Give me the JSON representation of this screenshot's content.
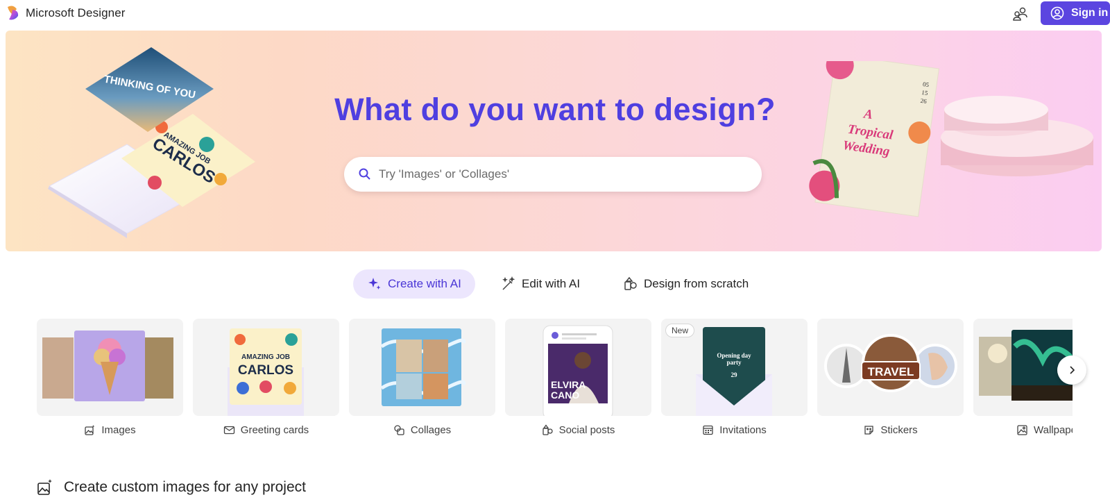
{
  "app": {
    "name": "Microsoft Designer"
  },
  "header": {
    "signin_label": "Sign in",
    "share_icon": "people-share-icon"
  },
  "hero": {
    "title": "What do you want to design?",
    "search_placeholder": "Try 'Images' or 'Collages'",
    "postcard_text": "THINKING OF YOU",
    "card_text": [
      "AMAZING JOB",
      "CARLOS"
    ],
    "invite_title": "A Tropical Wedding",
    "invite_date": [
      "05",
      "15",
      "26"
    ]
  },
  "tabs": [
    {
      "label": "Create with AI",
      "icon": "sparkle-icon",
      "active": true
    },
    {
      "label": "Edit with AI",
      "icon": "magic-wand-icon",
      "active": false
    },
    {
      "label": "Design from scratch",
      "icon": "shapes-icon",
      "active": false
    }
  ],
  "categories": [
    {
      "label": "Images",
      "icon": "image-sparkle-icon"
    },
    {
      "label": "Greeting cards",
      "icon": "mail-icon"
    },
    {
      "label": "Collages",
      "icon": "collage-icon"
    },
    {
      "label": "Social posts",
      "icon": "social-post-icon"
    },
    {
      "label": "Invitations",
      "icon": "calendar-icon",
      "badge": "New"
    },
    {
      "label": "Stickers",
      "icon": "sticker-icon"
    },
    {
      "label": "Wallpape",
      "icon": "wallpaper-icon"
    }
  ],
  "thumb_text": {
    "greeting": [
      "AMAZING JOB",
      "CARLOS"
    ],
    "social": [
      "ELVIRA",
      "CANO"
    ],
    "invitation": [
      "Opening day",
      "party",
      "29"
    ],
    "sticker": "TRAVEL"
  },
  "section": {
    "title": "Create custom images for any project"
  },
  "colors": {
    "accent": "#5b45e0",
    "title": "#4f3fe0",
    "tab_active_bg": "#ece6fd"
  }
}
